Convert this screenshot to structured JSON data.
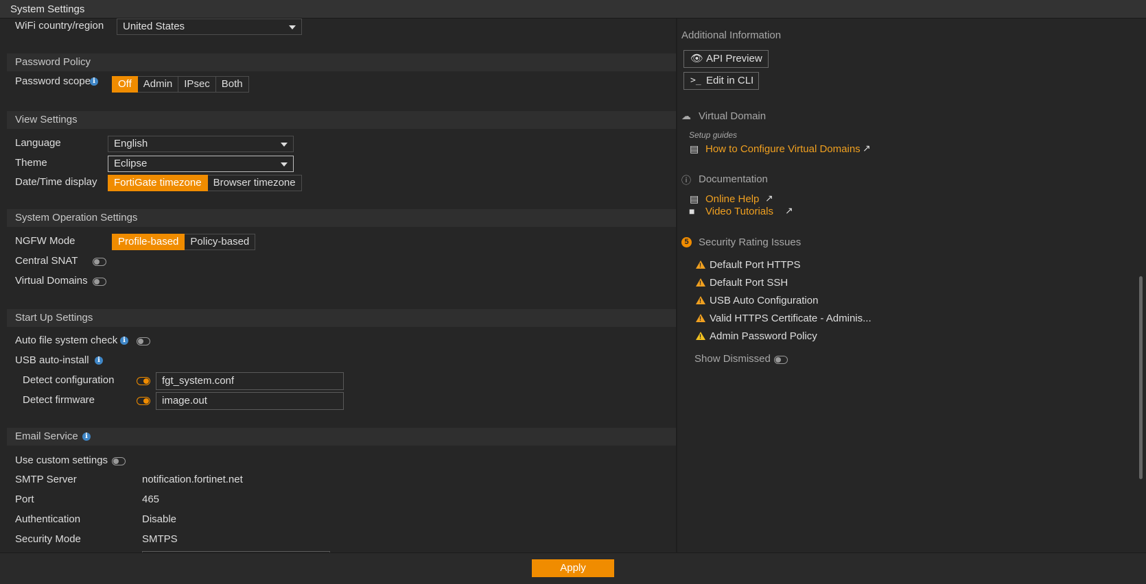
{
  "window": {
    "title": "System Settings"
  },
  "settings": {
    "wifi": {
      "label": "WiFi country/region",
      "value": "United States"
    },
    "password_policy": {
      "header": "Password Policy",
      "scope_label": "Password scope",
      "options": [
        "Off",
        "Admin",
        "IPsec",
        "Both"
      ],
      "selected": "Off"
    },
    "view_settings": {
      "header": "View Settings",
      "language_label": "Language",
      "language_value": "English",
      "theme_label": "Theme",
      "theme_value": "Eclipse",
      "datetime_label": "Date/Time display",
      "datetime_options": [
        "FortiGate timezone",
        "Browser timezone"
      ],
      "datetime_selected": "FortiGate timezone"
    },
    "system_operation": {
      "header": "System Operation Settings",
      "ngfw_label": "NGFW Mode",
      "ngfw_options": [
        "Profile-based",
        "Policy-based"
      ],
      "ngfw_selected": "Profile-based",
      "central_snat_label": "Central SNAT",
      "central_snat": false,
      "virtual_domains_label": "Virtual Domains",
      "virtual_domains": false
    },
    "startup": {
      "header": "Start Up Settings",
      "auto_fs_label": "Auto file system check",
      "auto_fs": false,
      "usb_label": "USB auto-install",
      "detect_config_label": "Detect configuration",
      "detect_config": true,
      "detect_config_value": "fgt_system.conf",
      "detect_firmware_label": "Detect firmware",
      "detect_firmware": true,
      "detect_firmware_value": "image.out"
    },
    "email": {
      "header": "Email Service",
      "custom_label": "Use custom settings",
      "custom": false,
      "smtp_label": "SMTP Server",
      "smtp_value": "notification.fortinet.net",
      "port_label": "Port",
      "port_value": "465",
      "auth_label": "Authentication",
      "auth_value": "Disable",
      "security_label": "Security Mode",
      "security_value": "SMTPS"
    }
  },
  "sidebar": {
    "additional_info": "Additional Information",
    "api_preview": "API Preview",
    "edit_cli": "Edit in CLI",
    "virtual_domain": {
      "heading": "Virtual Domain",
      "setup_guides": "Setup guides",
      "link": "How to Configure Virtual Domains"
    },
    "documentation": {
      "heading": "Documentation",
      "online_help": "Online Help",
      "video_tutorials": "Video Tutorials"
    },
    "security_rating": {
      "count": "5",
      "heading": "Security Rating Issues",
      "issues": [
        "Default Port HTTPS",
        "Default Port SSH",
        "USB Auto Configuration",
        "Valid HTTPS Certificate - Adminis...",
        "Admin Password Policy"
      ],
      "show_dismissed_label": "Show Dismissed",
      "show_dismissed": false
    }
  },
  "footer": {
    "apply": "Apply"
  },
  "colors": {
    "accent": "#f08c00",
    "info": "#3f86c6",
    "warning": "#f0a020",
    "background": "#262626"
  }
}
